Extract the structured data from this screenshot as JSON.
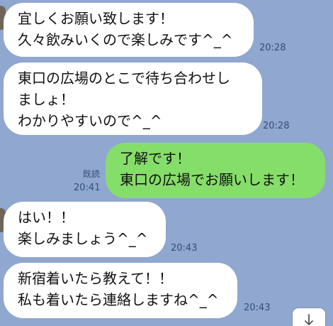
{
  "messages": [
    {
      "sender": "other",
      "lines": [
        "宜しくお願い致します！",
        "久々飲みいくので楽しみです^_^"
      ],
      "time": "20:28"
    },
    {
      "sender": "other",
      "lines": [
        "東口の広場のとこで待ち合わせし",
        "ましょ！",
        "わかりやすいので^_^"
      ],
      "time": "20:28"
    },
    {
      "sender": "me",
      "lines": [
        "了解です！",
        "東口の広場でお願いします！"
      ],
      "read_label": "既読",
      "time": "20:41"
    },
    {
      "sender": "other",
      "lines": [
        "はい！！",
        "楽しみましょう^_^"
      ],
      "time": "20:43"
    },
    {
      "sender": "other",
      "lines": [
        "新宿着いたら教えて！！",
        "私も着いたら連絡しますね^_^"
      ],
      "time": "20:43"
    }
  ],
  "icons": {
    "avatar": "avatar-edge",
    "scroll": "arrow-down-icon"
  },
  "colors": {
    "background": "#90a7cf",
    "incoming_bubble": "#ffffff",
    "outgoing_bubble": "#86de6a",
    "meta_text": "#344e77"
  }
}
